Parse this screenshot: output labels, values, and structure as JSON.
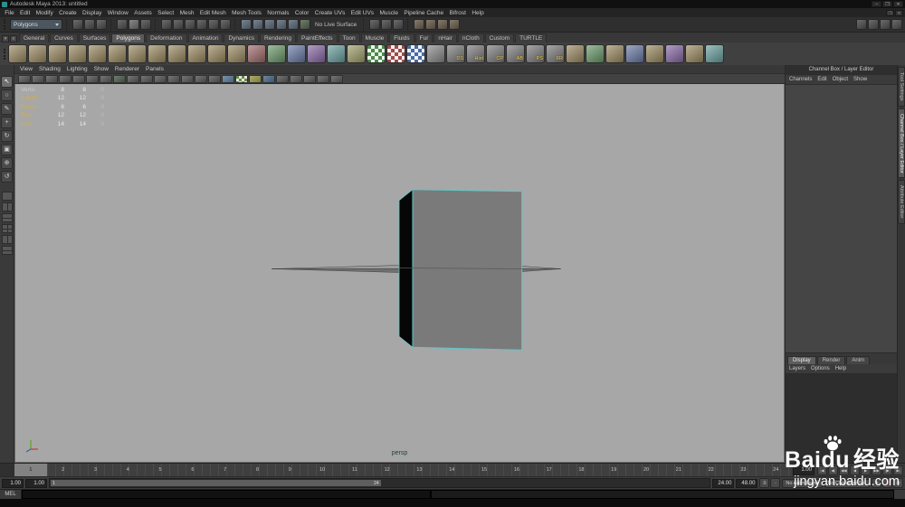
{
  "titlebar": {
    "title": "Autodesk Maya 2013: untitled",
    "controls": [
      {
        "n": "minimize-button",
        "g": "–"
      },
      {
        "n": "maximize-button",
        "g": "❐"
      },
      {
        "n": "close-button",
        "g": "✕"
      }
    ]
  },
  "menubar": {
    "items": [
      "File",
      "Edit",
      "Modify",
      "Create",
      "Display",
      "Window",
      "Assets",
      "Select",
      "Mesh",
      "Edit Mesh",
      "Mesh Tools",
      "Normals",
      "Color",
      "Create UVs",
      "Edit UVs",
      "Muscle",
      "Pipeline Cache",
      "Bifrost",
      "Help"
    ],
    "controls": [
      {
        "n": "restore-scene-window-button",
        "g": "❐"
      },
      {
        "n": "close-scene-window-button",
        "g": "✕"
      }
    ]
  },
  "statusline": {
    "menuset": "Polygons",
    "no_live_surface": "No Live Surface",
    "file_icons": [
      {
        "n": "new-scene-icon"
      },
      {
        "n": "open-scene-icon"
      },
      {
        "n": "save-scene-icon"
      }
    ],
    "select_mode_icons": [
      {
        "n": "select-by-hierarchy-icon"
      },
      {
        "n": "select-by-object-icon",
        "c": "#6e6e6e"
      },
      {
        "n": "select-by-component-icon"
      }
    ],
    "mask_icons": [
      {
        "n": "select-handles-mask-icon"
      },
      {
        "n": "select-joints-mask-icon"
      },
      {
        "n": "select-curves-mask-icon"
      },
      {
        "n": "select-surfaces-mask-icon"
      },
      {
        "n": "select-deformations-mask-icon"
      },
      {
        "n": "select-rendering-mask-icon"
      }
    ],
    "snap_icons": [
      {
        "n": "snap-to-grid-icon",
        "c": "#5c6a7a"
      },
      {
        "n": "snap-to-curve-icon",
        "c": "#5c6a7a"
      },
      {
        "n": "snap-to-point-icon",
        "c": "#5c6a7a"
      },
      {
        "n": "snap-to-projected-center-icon",
        "c": "#5c6a7a"
      },
      {
        "n": "snap-to-view-plane-icon",
        "c": "#5c6a7a"
      },
      {
        "n": "make-live-icon",
        "c": "#53624f"
      }
    ],
    "history_icons": [
      {
        "n": "input-to-selected-icon"
      },
      {
        "n": "output-from-selected-icon"
      },
      {
        "n": "construction-history-toggle-icon"
      }
    ],
    "render_icons": [
      {
        "n": "open-render-view-icon",
        "c": "#6b5f4e"
      },
      {
        "n": "render-current-frame-icon",
        "c": "#6b5f4e"
      },
      {
        "n": "ipr-render-icon",
        "c": "#6b5f4e"
      },
      {
        "n": "render-settings-icon",
        "c": "#6b5f4e"
      }
    ],
    "right_icons": [
      {
        "n": "show-manipulator-icon"
      },
      {
        "n": "toggle-attribute-editor-icon"
      },
      {
        "n": "toggle-tool-settings-icon"
      },
      {
        "n": "toggle-channel-box-icon"
      }
    ]
  },
  "shelf": {
    "left_buttons": [
      {
        "n": "shelf-tab-switch-icon",
        "g": "▾"
      },
      {
        "n": "shelf-menu-icon",
        "g": "≡"
      }
    ],
    "tabs": [
      {
        "label": "General"
      },
      {
        "label": "Curves"
      },
      {
        "label": "Surfaces"
      },
      {
        "label": "Polygons",
        "active": true
      },
      {
        "label": "Deformation"
      },
      {
        "label": "Animation"
      },
      {
        "label": "Dynamics"
      },
      {
        "label": "Rendering"
      },
      {
        "label": "PaintEffects"
      },
      {
        "label": "Toon"
      },
      {
        "label": "Muscle"
      },
      {
        "label": "Fluids"
      },
      {
        "label": "Fur"
      },
      {
        "label": "nHair"
      },
      {
        "label": "nCloth"
      },
      {
        "label": "Custom"
      },
      {
        "label": "TURTLE"
      }
    ],
    "icons": [
      {
        "n": "poly-sphere-icon",
        "c": "#9c8a60"
      },
      {
        "n": "poly-cube-icon",
        "c": "#9c8a60"
      },
      {
        "n": "poly-cylinder-icon",
        "c": "#9c8a60"
      },
      {
        "n": "poly-cone-icon",
        "c": "#9c8a60"
      },
      {
        "n": "poly-plane-icon",
        "c": "#9c8a60"
      },
      {
        "n": "poly-torus-icon",
        "c": "#9c8a60"
      },
      {
        "n": "poly-prism-icon",
        "c": "#9c8a60"
      },
      {
        "n": "poly-pyramid-icon",
        "c": "#9c8a60"
      },
      {
        "n": "poly-pipe-icon",
        "c": "#9c8a60"
      },
      {
        "n": "poly-helix-icon",
        "c": "#9c8a60"
      },
      {
        "n": "poly-soccer-ball-icon",
        "c": "#9c8a60"
      },
      {
        "n": "platonic-solid-icon",
        "c": "#9c8a60"
      },
      {
        "n": "combine-icon",
        "c": "#a06a6a"
      },
      {
        "n": "separate-icon",
        "c": "#6a9a6a"
      },
      {
        "n": "extract-icon",
        "c": "#6a7aa8"
      },
      {
        "n": "booleans-union-icon",
        "c": "#8a6aa8"
      },
      {
        "n": "booleans-difference-icon",
        "c": "#6aa0a0"
      },
      {
        "n": "booleans-intersection-icon",
        "c": "#a0a06a"
      },
      {
        "n": "smooth-icon",
        "c": "#4a8a4a",
        "ck": true
      },
      {
        "n": "average-vertices-icon",
        "c": "#a04a4a",
        "ck": true
      },
      {
        "n": "transfer-attributes-icon",
        "c": "#4a6aa0",
        "ck": true
      },
      {
        "n": "paint-transfer-weights-icon",
        "c": "#8a8a8a"
      },
      {
        "n": "delete-surface-icon",
        "t": "DS",
        "c": "#7a7a7a"
      },
      {
        "n": "delete-history-icon",
        "t": "Hist",
        "c": "#7a7a7a"
      },
      {
        "n": "center-pivot-icon",
        "t": "CP",
        "c": "#7a7a7a"
      },
      {
        "n": "assign-blinn-icon",
        "t": "AB",
        "c": "#7a7a7a"
      },
      {
        "n": "assign-phong-icon",
        "t": "PS",
        "c": "#7a7a7a"
      },
      {
        "n": "freeze-transform-icon",
        "t": "FR",
        "c": "#7a7a7a"
      },
      {
        "n": "extrude-icon",
        "c": "#9c8a60"
      },
      {
        "n": "bevel-icon",
        "c": "#6a9a6a"
      },
      {
        "n": "bridge-icon",
        "c": "#9c8a60"
      },
      {
        "n": "append-polygon-icon",
        "c": "#6a7aa8"
      },
      {
        "n": "split-polygon-icon",
        "c": "#9c8a60"
      },
      {
        "n": "insert-edge-loop-icon",
        "c": "#8a6aa8"
      },
      {
        "n": "multi-cut-icon",
        "c": "#9c8a60"
      },
      {
        "n": "quad-draw-icon",
        "c": "#6aa0a0"
      }
    ]
  },
  "toolbox": {
    "tools": [
      {
        "n": "select-tool",
        "g": "↖",
        "active": true
      },
      {
        "n": "lasso-tool",
        "g": "○"
      },
      {
        "n": "paint-select-tool",
        "g": "✎"
      },
      {
        "n": "move-tool",
        "g": "+"
      },
      {
        "n": "rotate-tool",
        "g": "↻"
      },
      {
        "n": "scale-tool",
        "g": "▣"
      },
      {
        "n": "universal-manipulator-tool",
        "g": "⊕"
      },
      {
        "n": "last-tool-used",
        "g": "↺"
      }
    ],
    "layouts": [
      {
        "n": "layout-single-pane",
        "v": "v1"
      },
      {
        "n": "layout-two-panes-side-by-side",
        "v": "v2"
      },
      {
        "n": "layout-two-panes-stacked",
        "v": "v3"
      },
      {
        "n": "layout-four-panes",
        "v": "v4"
      },
      {
        "n": "layout-persp-outliner",
        "v": "v2"
      },
      {
        "n": "layout-hypershade-persp",
        "v": "v3"
      }
    ]
  },
  "panel": {
    "menu": [
      "View",
      "Shading",
      "Lighting",
      "Show",
      "Renderer",
      "Panels"
    ],
    "toolbar": [
      {
        "n": "select-camera-icon"
      },
      {
        "n": "lock-camera-icon"
      },
      {
        "n": "camera-attributes-icon"
      },
      {
        "n": "bookmarks-icon"
      },
      {
        "n": "image-plane-icon"
      },
      {
        "n": "two-d-pan-zoom-icon"
      },
      {
        "n": "grease-pencil-icon"
      },
      {
        "n": "grid-toggle-icon",
        "c": "#4d5d4d"
      },
      {
        "n": "film-gate-icon"
      },
      {
        "n": "resolution-gate-icon"
      },
      {
        "n": "gate-mask-icon"
      },
      {
        "n": "field-chart-icon"
      },
      {
        "n": "safe-action-icon"
      },
      {
        "n": "safe-title-icon"
      },
      {
        "n": "wireframe-mode-icon"
      },
      {
        "n": "shaded-mode-icon",
        "c": "#5a7a9a"
      },
      {
        "n": "textured-mode-icon",
        "c": "#6a8a4a",
        "ck": true
      },
      {
        "n": "use-all-lights-icon",
        "c": "#9a9a4a"
      },
      {
        "n": "shadows-icon",
        "c": "#4a6a8a"
      },
      {
        "n": "screen-space-ao-icon"
      },
      {
        "n": "motion-blur-icon"
      },
      {
        "n": "multisampling-icon"
      },
      {
        "n": "xray-icon"
      },
      {
        "n": "isolate-select-icon"
      }
    ],
    "camera_label": "persp"
  },
  "hud": {
    "rows": [
      {
        "label": "Verts:",
        "v1": "8",
        "v2": "8",
        "v3": "0"
      },
      {
        "label": "Edges:",
        "v1": "12",
        "v2": "12",
        "v3": "0",
        "hl": true
      },
      {
        "label": "Faces:",
        "v1": "6",
        "v2": "6",
        "v3": "0",
        "hl": true
      },
      {
        "label": "Tris:",
        "v1": "12",
        "v2": "12",
        "v3": "0",
        "hl": true
      },
      {
        "label": "UVs:",
        "v1": "14",
        "v2": "14",
        "v3": "0",
        "hl": true
      }
    ]
  },
  "channel_box": {
    "title": "Channel Box / Layer Editor",
    "menu": [
      "Channels",
      "Edit",
      "Object",
      "Show"
    ],
    "side_tabs": [
      {
        "label": "Tool Settings"
      },
      {
        "label": "Channel Box / Layer Editor",
        "active": true
      },
      {
        "label": "Attribute Editor"
      }
    ]
  },
  "layer_editor": {
    "tabs": [
      {
        "label": "Display",
        "active": true
      },
      {
        "label": "Render"
      },
      {
        "label": "Anim"
      }
    ],
    "menu": [
      "Layers",
      "Options",
      "Help"
    ]
  },
  "time_slider": {
    "frames": [
      "1",
      "2",
      "3",
      "4",
      "5",
      "6",
      "7",
      "8",
      "9",
      "10",
      "11",
      "12",
      "13",
      "14",
      "15",
      "16",
      "17",
      "18",
      "19",
      "20",
      "21",
      "22",
      "23",
      "24"
    ],
    "current_frame": "1",
    "current_time": "1.00",
    "playback": [
      {
        "n": "go-to-start-button",
        "g": "|◀"
      },
      {
        "n": "step-back-frame-button",
        "g": "◀|"
      },
      {
        "n": "step-back-key-button",
        "g": "◀◀"
      },
      {
        "n": "play-backwards-button",
        "g": "◀"
      },
      {
        "n": "play-forwards-button",
        "g": "▶"
      },
      {
        "n": "step-forward-key-button",
        "g": "▶▶"
      },
      {
        "n": "step-forward-frame-button",
        "g": "|▶"
      },
      {
        "n": "go-to-end-button",
        "g": "▶|"
      }
    ]
  },
  "range_slider": {
    "playback_start": "1.00",
    "anim_start": "1.00",
    "range_start_label": "1",
    "range_end_label": "24",
    "playback_end": "24.00",
    "anim_end": "48.00",
    "anim_layer": "No Anim Layer",
    "character_set": "No Character Set",
    "buttons_a": [
      {
        "n": "anim-layer-filter-icon",
        "g": "≡"
      },
      {
        "n": "anim-layer-weight-icon",
        "g": "∙"
      }
    ],
    "buttons_b": [
      {
        "n": "set-key-icon",
        "g": "∗"
      },
      {
        "n": "auto-keyframe-toggle",
        "g": "●",
        "c": "#c84444"
      },
      {
        "n": "animation-preferences-icon",
        "g": "≋"
      }
    ]
  },
  "command_line": {
    "label": "MEL"
  },
  "watermark": {
    "brand_prefix": "Bai",
    "brand_suffix": "du",
    "brand_cn": "经验",
    "url": "jingyan.baidu.com"
  }
}
